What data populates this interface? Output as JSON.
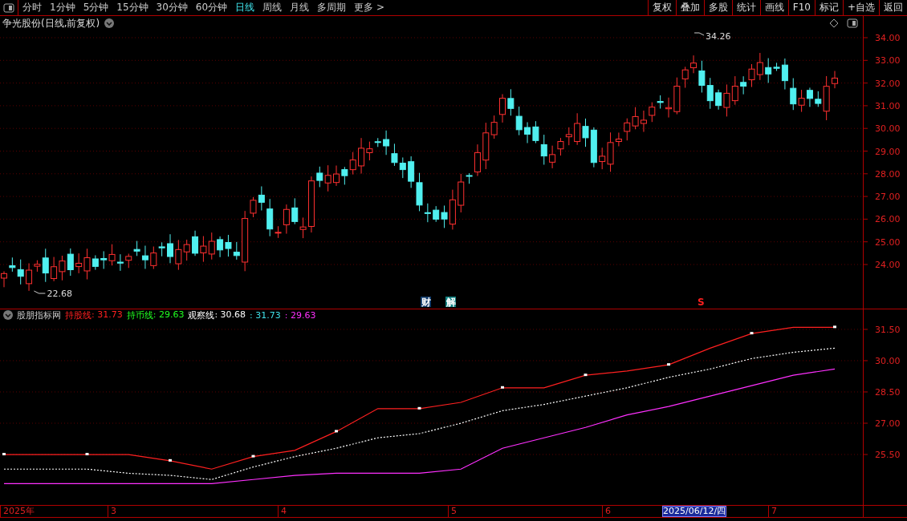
{
  "toolbar": {
    "periods": [
      {
        "label": "分时",
        "selected": false
      },
      {
        "label": "1分钟",
        "selected": false
      },
      {
        "label": "5分钟",
        "selected": false
      },
      {
        "label": "15分钟",
        "selected": false
      },
      {
        "label": "30分钟",
        "selected": false
      },
      {
        "label": "60分钟",
        "selected": false
      },
      {
        "label": "日线",
        "selected": true
      },
      {
        "label": "周线",
        "selected": false
      },
      {
        "label": "月线",
        "selected": false
      },
      {
        "label": "多周期",
        "selected": false
      },
      {
        "label": "更多 >",
        "selected": false
      }
    ],
    "buttons": [
      "复权",
      "叠加",
      "多股",
      "统计",
      "画线",
      "F10",
      "标记",
      "+自选",
      "返回"
    ]
  },
  "chart_header": {
    "title": "争光股份(日线,前复权)"
  },
  "price_chart": {
    "axis_labels": [
      "34.00",
      "33.00",
      "32.00",
      "31.00",
      "30.00",
      "29.00",
      "28.00",
      "27.00",
      "26.00",
      "25.00",
      "24.00"
    ],
    "high_label": "34.26",
    "low_label": "22.68",
    "event_marks": [
      {
        "label": "财",
        "kind": "finance"
      },
      {
        "label": "解",
        "kind": "unlock"
      },
      {
        "label": "S",
        "kind": "signal"
      }
    ]
  },
  "indicator": {
    "name": "股朋指标网",
    "legend": [
      {
        "value": ": 31.73",
        "color": "#ff2020"
      },
      {
        "value": ": 29.63",
        "color": "#20ff20"
      },
      {
        "value": ": 30.68",
        "color": "#ffffff"
      },
      {
        "value": ": 31.73",
        "color": "#40e0e8"
      },
      {
        "value": ": 29.63",
        "color": "#ff30ff"
      }
    ],
    "chart_data": {
      "type": "line",
      "categories": [
        null,
        null,
        null,
        null,
        null,
        null,
        null,
        null,
        null,
        null,
        null,
        null,
        null,
        null,
        null,
        null,
        null,
        null,
        null,
        null,
        null
      ],
      "ylim": [
        23.08,
        31.92
      ],
      "grid": true,
      "yticks": [
        {
          "value": 31.5,
          "label": "31.50"
        },
        {
          "value": 30,
          "label": "30.00"
        },
        {
          "value": 28.5,
          "label": "28.50"
        },
        {
          "value": 27,
          "label": "27.00"
        },
        {
          "value": 25.5,
          "label": "25.50"
        }
      ],
      "series": [
        {
          "name": "持股线",
          "line_style": "solid",
          "color": "#ff2020",
          "values": [
            25.5,
            25.5,
            25.5,
            25.5,
            25.2,
            24.8,
            25.4,
            25.7,
            26.6,
            27.7,
            27.7,
            28.0,
            28.7,
            28.7,
            29.3,
            29.5,
            29.8,
            30.6,
            31.3,
            31.6,
            31.6
          ]
        },
        {
          "name": "持币线",
          "line_style": "solid",
          "color": "#ff30ff",
          "values": [
            24.1,
            24.1,
            24.1,
            24.1,
            24.1,
            24.1,
            24.3,
            24.5,
            24.6,
            24.6,
            24.6,
            24.8,
            25.8,
            26.3,
            26.8,
            27.4,
            27.8,
            28.3,
            28.8,
            29.3,
            29.6
          ]
        },
        {
          "name": "观察线",
          "line_style": "dashed",
          "color": "#ffffff",
          "values": [
            24.8,
            24.8,
            24.8,
            24.6,
            24.5,
            24.3,
            24.9,
            25.4,
            25.8,
            26.3,
            26.5,
            27.0,
            27.6,
            27.9,
            28.3,
            28.7,
            29.2,
            29.6,
            30.1,
            30.4,
            30.6
          ]
        }
      ]
    }
  },
  "date_axis": {
    "labels": [
      "2025年",
      "3",
      "4",
      "5",
      "6",
      "7"
    ],
    "cursor_date": "2025/06/12/四"
  }
}
